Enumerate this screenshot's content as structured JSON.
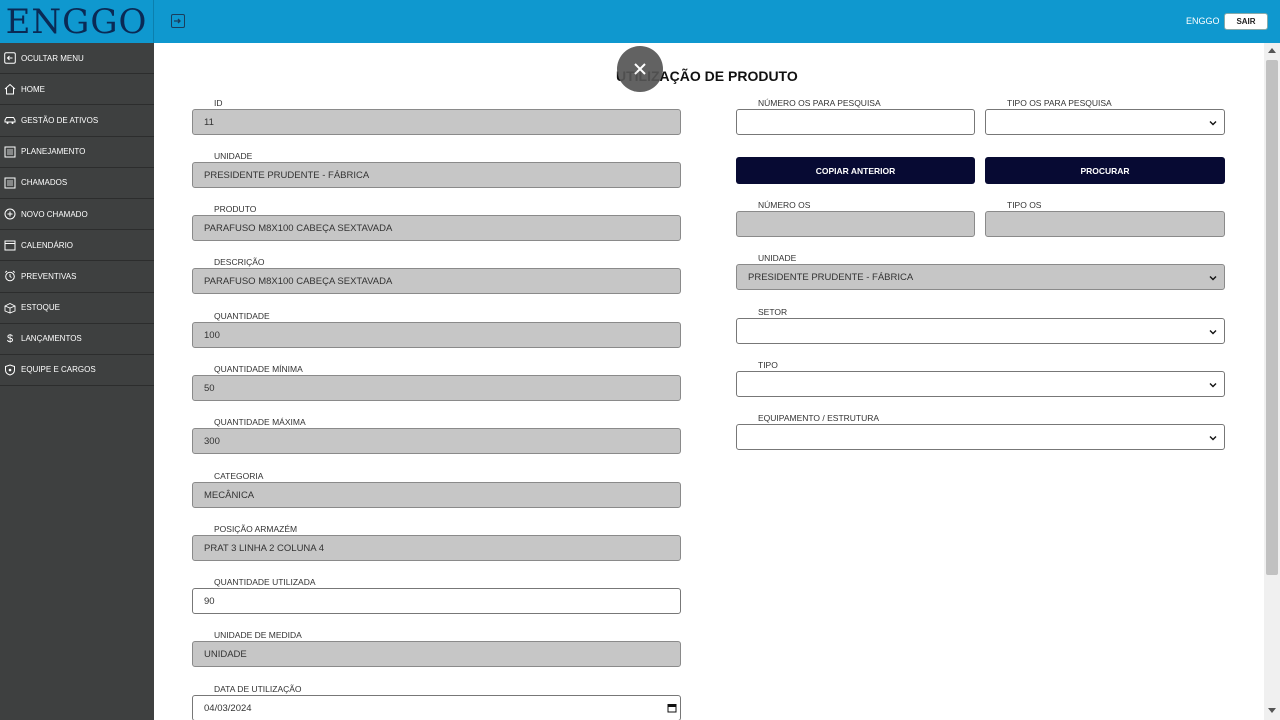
{
  "app": {
    "logo": "ENGGO",
    "user": "ENGGO",
    "logout_label": "SAIR"
  },
  "colors": {
    "topbar": "#0f98cf",
    "sidebar": "#3e4040",
    "button_dark": "#070a33",
    "readonly_field": "#c6c6c6"
  },
  "sidebar": {
    "items": [
      {
        "label": "OCULTAR MENU",
        "icon": "hide-menu-icon"
      },
      {
        "label": "HOME",
        "icon": "home-icon"
      },
      {
        "label": "GESTÃO DE ATIVOS",
        "icon": "car-icon"
      },
      {
        "label": "PLANEJAMENTO",
        "icon": "list-icon"
      },
      {
        "label": "CHAMADOS",
        "icon": "list-icon"
      },
      {
        "label": "NOVO CHAMADO",
        "icon": "plus-circle-icon"
      },
      {
        "label": "CALENDÁRIO",
        "icon": "calendar-icon"
      },
      {
        "label": "PREVENTIVAS",
        "icon": "alarm-icon"
      },
      {
        "label": "ESTOQUE",
        "icon": "box-icon"
      },
      {
        "label": "LANÇAMENTOS",
        "icon": "dollar-icon"
      },
      {
        "label": "EQUIPE E CARGOS",
        "icon": "shield-icon"
      }
    ]
  },
  "page": {
    "title": "UTILIZAÇÃO DE PRODUTO"
  },
  "form_left": {
    "id": {
      "label": "ID",
      "value": "11"
    },
    "unidade": {
      "label": "UNIDADE",
      "value": "PRESIDENTE PRUDENTE - FÁBRICA"
    },
    "produto": {
      "label": "PRODUTO",
      "value": "PARAFUSO M8X100 CABEÇA SEXTAVADA"
    },
    "descricao": {
      "label": "DESCRIÇÃO",
      "value": "PARAFUSO M8X100 CABEÇA SEXTAVADA"
    },
    "quantidade": {
      "label": "QUANTIDADE",
      "value": "100"
    },
    "quantidade_minima": {
      "label": "QUANTIDADE MÍNIMA",
      "value": "50"
    },
    "quantidade_maxima": {
      "label": "QUANTIDADE MÁXIMA",
      "value": "300"
    },
    "categoria": {
      "label": "CATEGORIA",
      "value": "MECÂNICA"
    },
    "posicao_armazem": {
      "label": "POSIÇÃO ARMAZÉM",
      "value": "PRAT 3 LINHA 2 COLUNA 4"
    },
    "quantidade_utilizada": {
      "label": "QUANTIDADE UTILIZADA",
      "value": "90"
    },
    "unidade_medida": {
      "label": "UNIDADE DE MEDIDA",
      "value": "UNIDADE"
    },
    "data_utilizacao": {
      "label": "DATA DE UTILIZAÇÃO",
      "value": "04/03/2024"
    }
  },
  "form_right": {
    "numero_os_pesquisa": {
      "label": "NÚMERO OS PARA PESQUISA",
      "value": ""
    },
    "tipo_os_pesquisa": {
      "label": "TIPO OS PARA PESQUISA",
      "value": ""
    },
    "copiar_anterior_label": "COPIAR ANTERIOR",
    "procurar_label": "PROCURAR",
    "numero_os": {
      "label": "NÚMERO OS",
      "value": ""
    },
    "tipo_os": {
      "label": "TIPO OS",
      "value": ""
    },
    "unidade": {
      "label": "UNIDADE",
      "value": "PRESIDENTE PRUDENTE - FÁBRICA"
    },
    "setor": {
      "label": "SETOR",
      "value": ""
    },
    "tipo": {
      "label": "TIPO",
      "value": ""
    },
    "equipamento": {
      "label": "EQUIPAMENTO / ESTRUTURA",
      "value": ""
    }
  }
}
